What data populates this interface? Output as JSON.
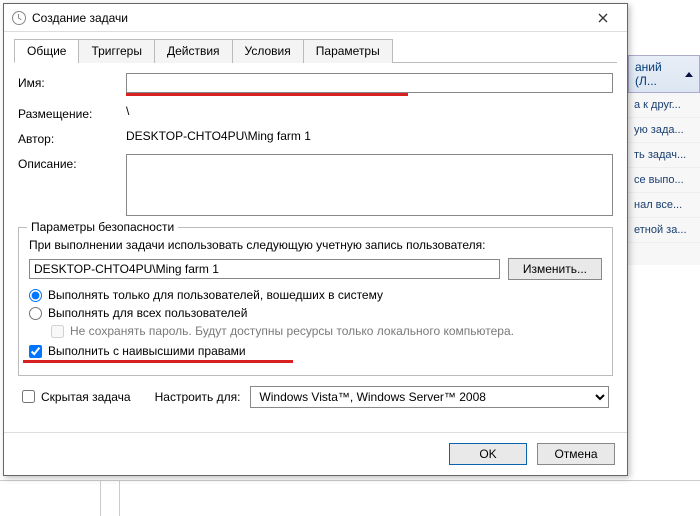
{
  "window": {
    "title": "Создание задачи"
  },
  "tabs": {
    "general": "Общие",
    "triggers": "Триггеры",
    "actions": "Действия",
    "conditions": "Условия",
    "settings": "Параметры"
  },
  "form": {
    "name_label": "Имя:",
    "name_value": "",
    "location_label": "Размещение:",
    "location_value": "\\",
    "author_label": "Автор:",
    "author_value": "DESKTOP-CHTO4PU\\Ming farm 1",
    "description_label": "Описание:",
    "description_value": ""
  },
  "security": {
    "group_title": "Параметры безопасности",
    "run_as_label": "При выполнении задачи использовать следующую учетную запись пользователя:",
    "account": "DESKTOP-CHTO4PU\\Ming farm 1",
    "change_btn": "Изменить...",
    "radio_logged_on": "Выполнять только для пользователей, вошедших в систему",
    "radio_all_users": "Выполнять для всех пользователей",
    "no_store_password": "Не сохранять пароль. Будут доступны ресурсы только локального компьютера.",
    "highest_priv": "Выполнить с наивысшими правами"
  },
  "bottom": {
    "hidden_task": "Скрытая задача",
    "configure_for_label": "Настроить для:",
    "configure_for_value": "Windows Vista™, Windows Server™ 2008"
  },
  "buttons": {
    "ok": "OK",
    "cancel": "Отмена"
  },
  "side": {
    "header": "аний (Л...",
    "items": [
      "а к друг...",
      "ую зада...",
      "ть задач...",
      "се выпо...",
      "нал все...",
      "етной за..."
    ]
  }
}
